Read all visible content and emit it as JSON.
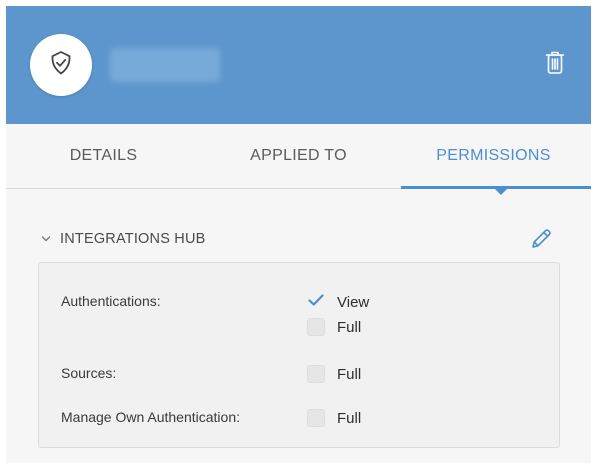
{
  "colors": {
    "header_bg": "#5d96cd",
    "accent": "#4c8fd1",
    "panel_bg": "#f6f6f6",
    "box_bg": "#f1f1f1"
  },
  "header": {
    "avatar_icon": "shield-check-icon",
    "delete_icon": "trash-icon"
  },
  "tabs": [
    {
      "label": "DETAILS",
      "active": false
    },
    {
      "label": "APPLIED TO",
      "active": false
    },
    {
      "label": "PERMISSIONS",
      "active": true
    }
  ],
  "section": {
    "title": "INTEGRATIONS HUB",
    "expanded": true,
    "edit_icon": "pencil-icon"
  },
  "permissions": [
    {
      "label": "Authentications:",
      "options": [
        {
          "label": "View",
          "checked": true
        },
        {
          "label": "Full",
          "checked": false
        }
      ]
    },
    {
      "label": "Sources:",
      "options": [
        {
          "label": "Full",
          "checked": false
        }
      ]
    },
    {
      "label": "Manage Own Authentication:",
      "options": [
        {
          "label": "Full",
          "checked": false
        }
      ]
    }
  ]
}
